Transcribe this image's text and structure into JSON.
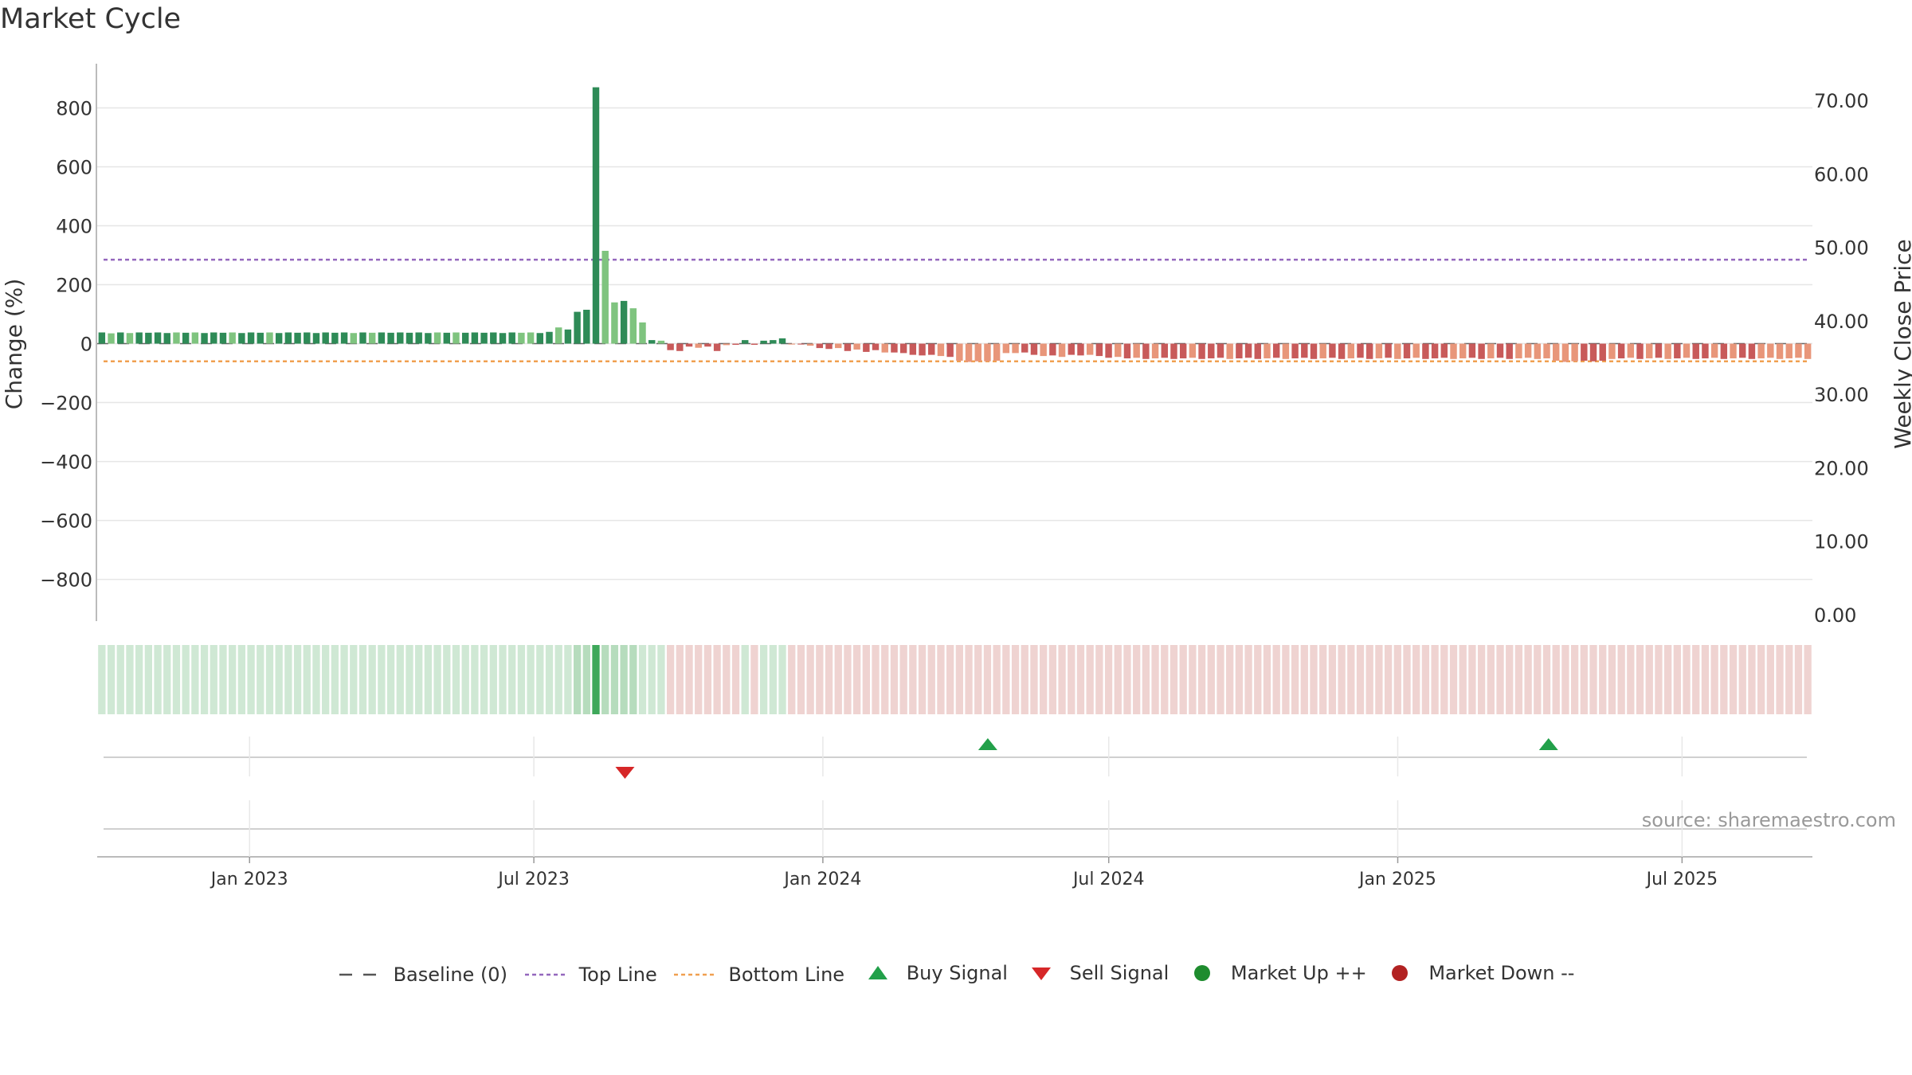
{
  "title": "Market Cycle",
  "source_note": "source: sharemaestro.com",
  "colors": {
    "up_strong": "#2e8b57",
    "up_light": "#7fc47f",
    "down_strong": "#c85a5a",
    "down_light": "#e8967a",
    "top_line": "#9467bd",
    "bottom_line": "#f0a050",
    "buy": "#22a04a",
    "sell": "#d62728",
    "strip_up": "#cfe8d4",
    "strip_up_mid": "#b6dcbd",
    "strip_up_peak": "#3ea85a",
    "strip_down": "#efd3d1",
    "grid": "#e6e6e6"
  },
  "legend": [
    {
      "label": "Baseline (0)",
      "icon": "dash-line-gray"
    },
    {
      "label": "Top Line",
      "icon": "dotted-line-purple"
    },
    {
      "label": "Bottom Line",
      "icon": "dotted-line-orange"
    },
    {
      "label": "Buy Signal",
      "icon": "triangle-up-green"
    },
    {
      "label": "Sell Signal",
      "icon": "triangle-down-red"
    },
    {
      "label": "Market Up ++",
      "icon": "circle-green"
    },
    {
      "label": "Market Down --",
      "icon": "circle-red"
    }
  ],
  "chart_data": {
    "type": "bar",
    "title": "Market Cycle",
    "ylabel": "Change (%)",
    "y2label": "Weekly Close Price",
    "ylim": [
      -920,
      950
    ],
    "yticks": [
      -800,
      -600,
      -400,
      -200,
      0,
      200,
      400,
      600,
      800
    ],
    "ytick_labels": [
      "−800",
      "−600",
      "−400",
      "−200",
      "0",
      "200",
      "400",
      "600",
      "800"
    ],
    "y2lim": [
      0,
      75
    ],
    "y2ticks": [
      0,
      10,
      20,
      30,
      40,
      50,
      60,
      70
    ],
    "y2tick_labels": [
      "0.00",
      "10.00",
      "20.00",
      "30.00",
      "40.00",
      "50.00",
      "60.00",
      "70.00"
    ],
    "xlim": [
      "2022-09-26",
      "2025-09-22"
    ],
    "xticks": [
      "2023-01-01",
      "2023-07-01",
      "2024-01-01",
      "2024-07-01",
      "2025-01-01",
      "2025-07-01"
    ],
    "xtick_labels": [
      "Jan 2023",
      "Jul 2023",
      "Jan 2024",
      "Jul 2024",
      "Jan 2025",
      "Jul 2025"
    ],
    "top_line": 285,
    "bottom_line": -60,
    "baseline": 0,
    "grid": true,
    "legend_position": "bottom",
    "change_pct": [
      38,
      35,
      38,
      36,
      38,
      37,
      38,
      36,
      38,
      37,
      38,
      36,
      38,
      37,
      38,
      36,
      38,
      37,
      38,
      36,
      38,
      37,
      38,
      36,
      38,
      37,
      38,
      36,
      38,
      37,
      38,
      37,
      38,
      37,
      38,
      36,
      38,
      37,
      38,
      37,
      38,
      37,
      38,
      36,
      38,
      37,
      38,
      36,
      40,
      55,
      48,
      108,
      115,
      870,
      315,
      140,
      145,
      120,
      72,
      12,
      10,
      -22,
      -25,
      -10,
      -14,
      -10,
      -25,
      -5,
      -4,
      12,
      -4,
      10,
      12,
      18,
      -3,
      -3,
      -7,
      -15,
      -18,
      -15,
      -25,
      -20,
      -28,
      -22,
      -30,
      -30,
      -32,
      -38,
      -40,
      -38,
      -42,
      -45,
      -58,
      -62,
      -60,
      -60,
      -58,
      -32,
      -32,
      -30,
      -38,
      -42,
      -40,
      -45,
      -38,
      -40,
      -38,
      -42,
      -48,
      -45,
      -50,
      -48,
      -52,
      -50,
      -48,
      -52,
      -50,
      -48,
      -52,
      -50,
      -48,
      -52,
      -50,
      -48,
      -52,
      -50,
      -48,
      -52,
      -50,
      -48,
      -52,
      -50,
      -48,
      -52,
      -50,
      -48,
      -52,
      -50,
      -48,
      -52,
      -50,
      -48,
      -52,
      -50,
      -48,
      -52,
      -50,
      -48,
      -52,
      -50,
      -48,
      -52,
      -50,
      -48,
      -52,
      -50,
      -58,
      -62,
      -60,
      -58,
      -60,
      -58,
      -52,
      -50,
      -48,
      -52,
      -50,
      -48,
      -52,
      -50,
      -48,
      -52,
      -50,
      -48,
      -52,
      -50,
      -48,
      -52,
      -50,
      -48,
      -52,
      -50,
      -48,
      -52
    ],
    "strength": [
      "S",
      "L",
      "S",
      "L",
      "S",
      "S",
      "S",
      "S",
      "L",
      "S",
      "L",
      "S",
      "S",
      "S",
      "L",
      "S",
      "S",
      "S",
      "L",
      "S",
      "S",
      "S",
      "S",
      "S",
      "S",
      "S",
      "S",
      "L",
      "S",
      "L",
      "S",
      "S",
      "S",
      "S",
      "S",
      "S",
      "L",
      "S",
      "L",
      "S",
      "S",
      "S",
      "S",
      "S",
      "S",
      "L",
      "L",
      "S",
      "S",
      "L",
      "S",
      "S",
      "S",
      "S",
      "L",
      "L",
      "S",
      "L",
      "L",
      "S",
      "L",
      "S",
      "S",
      "S",
      "L",
      "S",
      "S",
      "L",
      "S",
      "S",
      "S",
      "S",
      "S",
      "S",
      "L",
      "S",
      "L",
      "S",
      "S",
      "L",
      "S",
      "L",
      "S",
      "S",
      "L",
      "S",
      "S",
      "S",
      "S",
      "S",
      "L",
      "S",
      "L",
      "L",
      "L",
      "L",
      "L",
      "L",
      "L",
      "S",
      "S",
      "L",
      "S",
      "L",
      "S",
      "S",
      "L",
      "S",
      "S",
      "L",
      "S",
      "L",
      "S",
      "L",
      "S",
      "S",
      "S",
      "L",
      "S",
      "S",
      "S",
      "L",
      "S",
      "S",
      "S",
      "L",
      "S",
      "L",
      "S",
      "S",
      "S",
      "L",
      "S",
      "S",
      "L",
      "S",
      "S",
      "L",
      "S",
      "L",
      "S",
      "L",
      "S",
      "S",
      "S",
      "L",
      "L",
      "S",
      "S",
      "L",
      "S",
      "S",
      "L",
      "L",
      "L",
      "L",
      "L",
      "L",
      "L",
      "S",
      "S",
      "S",
      "L",
      "S",
      "L",
      "S",
      "L",
      "S",
      "L",
      "S",
      "L",
      "S",
      "S",
      "L",
      "S",
      "L",
      "S",
      "S"
    ],
    "buy_signals": [
      "2024-04-15",
      "2025-04-07"
    ],
    "sell_signals": [
      "2023-08-28"
    ],
    "market_up_weeks": [
      "2023-08-28"
    ],
    "market_down_weeks": []
  }
}
